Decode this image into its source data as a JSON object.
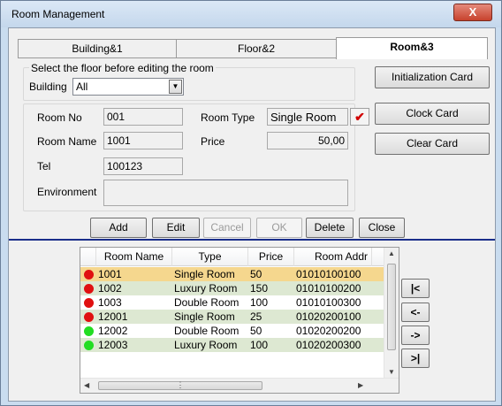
{
  "window": {
    "title": "Room Management",
    "close_glyph": "X"
  },
  "tabs": [
    {
      "label": "Building&1",
      "active": false
    },
    {
      "label": "Floor&2",
      "active": false
    },
    {
      "label": "Room&3",
      "active": true
    }
  ],
  "floor_group": {
    "caption": "Select the floor before editing the room",
    "building_label": "Building",
    "building_value": "All"
  },
  "room_form": {
    "room_no_label": "Room No",
    "room_no_value": "001",
    "room_type_label": "Room Type",
    "room_type_value": "Single Room",
    "room_name_label": "Room Name",
    "room_name_value": "1001",
    "price_label": "Price",
    "price_value": "50,00",
    "tel_label": "Tel",
    "tel_value": "100123",
    "environment_label": "Environment",
    "environment_value": ""
  },
  "card_buttons": {
    "init": "Initialization Card",
    "clock": "Clock Card",
    "clear": "Clear Card"
  },
  "actions": {
    "add": "Add",
    "edit": "Edit",
    "cancel": "Cancel",
    "ok": "OK",
    "delete": "Delete",
    "close": "Close"
  },
  "grid": {
    "columns": [
      "Room Name",
      "Type",
      "Price",
      "Room Addr"
    ],
    "rows": [
      {
        "name": "1001",
        "type": "Single Room",
        "price": "50",
        "addr": "01010100100",
        "status": "red",
        "selected": true
      },
      {
        "name": "1002",
        "type": "Luxury Room",
        "price": "150",
        "addr": "01010100200",
        "status": "red",
        "selected": false
      },
      {
        "name": "1003",
        "type": "Double Room",
        "price": "100",
        "addr": "01010100300",
        "status": "red",
        "selected": false
      },
      {
        "name": "12001",
        "type": "Single Room",
        "price": "25",
        "addr": "01020200100",
        "status": "red",
        "selected": false
      },
      {
        "name": "12002",
        "type": "Double Room",
        "price": "50",
        "addr": "01020200200",
        "status": "green",
        "selected": false
      },
      {
        "name": "12003",
        "type": "Luxury Room",
        "price": "100",
        "addr": "01020200300",
        "status": "green",
        "selected": false
      }
    ]
  },
  "nav_buttons": {
    "first": "|<",
    "prev": "<-",
    "next": "->",
    "last": ">|"
  },
  "colors": {
    "status_red": "#e01010",
    "status_green": "#22dd22",
    "row_selected": "#f5d78e",
    "row_even": "#ffffff",
    "row_odd": "#dde8d2"
  }
}
